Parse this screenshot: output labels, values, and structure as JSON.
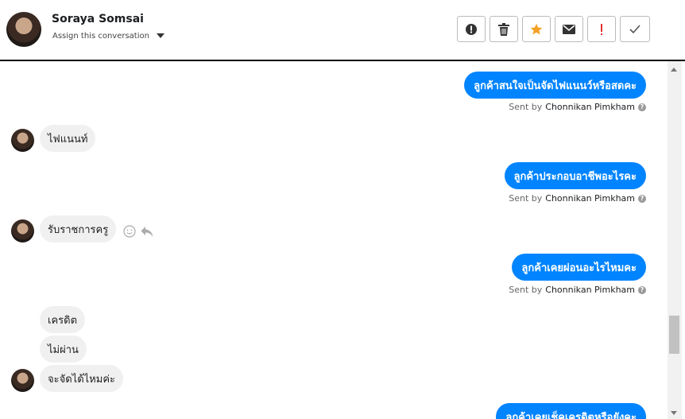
{
  "header": {
    "contact_name": "Soraya Somsai",
    "assign_label": "Assign this conversation",
    "actions": [
      {
        "name": "alert-circle-icon"
      },
      {
        "name": "trash-icon"
      },
      {
        "name": "star-icon",
        "color": "#f4a024"
      },
      {
        "name": "envelope-icon"
      },
      {
        "name": "important-icon",
        "color": "#e03030"
      },
      {
        "name": "check-icon"
      }
    ]
  },
  "messages": {
    "out1": {
      "text": "ลูกค้าสนใจเป็นจัดไฟแนนว์หรือสดคะ",
      "sent_by": "Sent by",
      "sender": "Chonnikan Pimkham"
    },
    "in1": {
      "text": "ไฟแนนท์"
    },
    "out2": {
      "text": "ลูกค้าประกอบอาชีพอะไรคะ",
      "sent_by": "Sent by",
      "sender": "Chonnikan Pimkham"
    },
    "in2": {
      "text": "รับราชการครู"
    },
    "out3": {
      "text": "ลูกค้าเคยผ่อนอะไรไหมคะ",
      "sent_by": "Sent by",
      "sender": "Chonnikan Pimkham"
    },
    "in3": {
      "text": "เครดิต"
    },
    "in4": {
      "text": "ไม่ผ่าน"
    },
    "in5": {
      "text": "จะจัดได้ไหมค่ะ"
    },
    "out4": {
      "text": "ลูกค้าเคยเช็คเครดิตหรือยังคะ"
    }
  },
  "colors": {
    "outgoing_bubble": "#0084ff",
    "incoming_bubble": "#f1f0f0"
  }
}
